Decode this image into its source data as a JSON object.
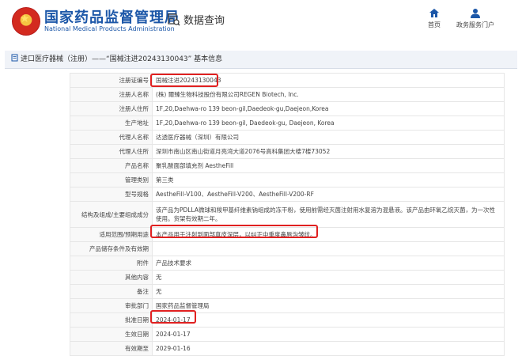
{
  "header": {
    "title_cn": "国家药品监督管理局",
    "title_en": "National Medical Products Administration",
    "search_label": "数据查询",
    "nav": [
      {
        "label": "首页",
        "icon": "home-icon"
      },
      {
        "label": "政务服务门户",
        "icon": "user-icon"
      }
    ]
  },
  "banner": {
    "text": "进口医疗器械（注册）——“国械注进20243130043” 基本信息"
  },
  "rows": [
    {
      "label": "注册证编号",
      "value": "国械注进20243130043"
    },
    {
      "label": "注册人名称",
      "value": "(株) 爾臻生物科技股份有限公司REGEN Biotech, Inc."
    },
    {
      "label": "注册人住所",
      "value": "1F,20,Daehwa-ro 139 beon-gil,Daedeok-gu,Daejeon,Korea"
    },
    {
      "label": "生产地址",
      "value": "1F,20,Daehwa-ro 139 beon-gil, Daedeok-gu, Daejeon, Korea"
    },
    {
      "label": "代理人名称",
      "value": "达透医疗器械（深圳）有限公司"
    },
    {
      "label": "代理人住所",
      "value": "深圳市南山区南山街道月亮湾大道2076号高科集团大楼7楼73052"
    },
    {
      "label": "产品名称",
      "value": "聚乳酸面部填充剂 AestheFill"
    },
    {
      "label": "管理类别",
      "value": "第三类"
    },
    {
      "label": "型号规格",
      "value": "AestheFill-V100、AestheFill-V200、AestheFill-V200-RF"
    },
    {
      "label": "结构及组成/主要组成成分",
      "value": "该产品为PDLLA微球和羧甲基纤维素钠组成的冻干粉，使用前需经灭菌注射用水复溶为混悬液。该产品由环氧乙烷灭菌，为一次性使用。货架有效期二年。"
    },
    {
      "label": "适用范围/预期用途",
      "value": "本产品用于注射到面部真皮深层，以纠正中重度鼻唇沟皱纹。"
    },
    {
      "label": "产品储存条件及有效期",
      "value": ""
    },
    {
      "label": "附件",
      "value": "产品技术要求"
    },
    {
      "label": "其他内容",
      "value": "无"
    },
    {
      "label": "备注",
      "value": "无"
    },
    {
      "label": "审批部门",
      "value": "国家药品监督管理局"
    },
    {
      "label": "批准日期",
      "value": "2024-01-17"
    },
    {
      "label": "生效日期",
      "value": "2024-01-17"
    },
    {
      "label": "有效期至",
      "value": "2029-01-16"
    }
  ],
  "colors": {
    "brand": "#1c57a8",
    "highlight": "#e02020"
  }
}
